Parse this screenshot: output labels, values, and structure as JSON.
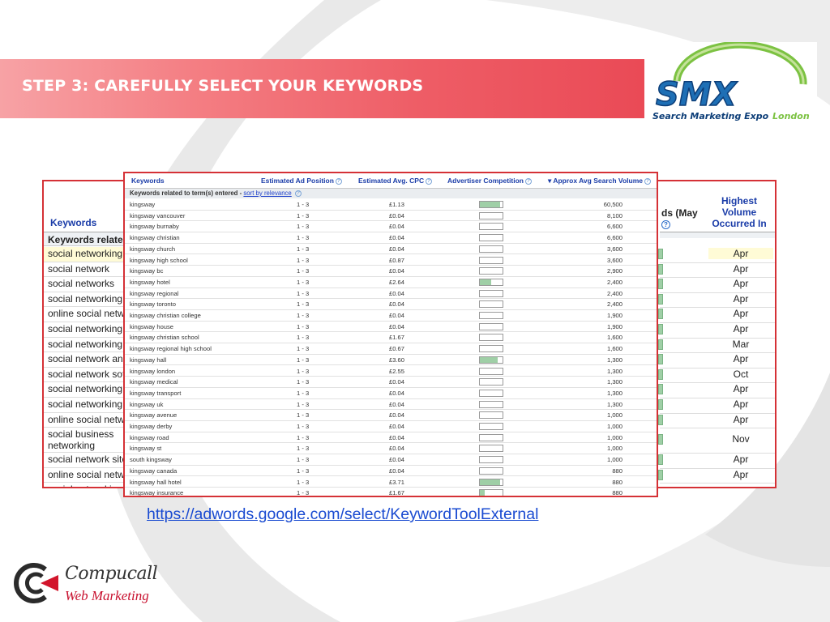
{
  "slide_title": "STEP 3: CAREFULLY SELECT YOUR KEYWORDS",
  "smx_logo": {
    "name": "SMX",
    "tagline_a": "Search Marketing Expo",
    "tagline_b": "London"
  },
  "back_table": {
    "keywords_header": "Keywords",
    "related_label": "Keywords related to term(s) entered",
    "search_header": "ds (May",
    "highest_header": "Highest Volume Occurred In",
    "rows": [
      {
        "kw": "social networking",
        "month": "Apr",
        "highlight": true
      },
      {
        "kw": "social network",
        "month": "Apr"
      },
      {
        "kw": "social networks",
        "month": "Apr"
      },
      {
        "kw": "social networking s",
        "month": "Apr"
      },
      {
        "kw": "online social netwo",
        "month": "Apr"
      },
      {
        "kw": "social networking s",
        "month": "Apr"
      },
      {
        "kw": "social networking s",
        "month": "Mar"
      },
      {
        "kw": "social network ana",
        "month": "Apr"
      },
      {
        "kw": "social network soft",
        "month": "Oct"
      },
      {
        "kw": "social networking w",
        "month": "Apr"
      },
      {
        "kw": "social networking w",
        "month": "Apr"
      },
      {
        "kw": "online social netwo",
        "month": "Apr"
      },
      {
        "kw": "social business networking",
        "month": "Nov"
      },
      {
        "kw": "social network site",
        "month": "Apr"
      },
      {
        "kw": "online social netwo",
        "month": "Apr"
      },
      {
        "kw": "social networking",
        "month": ""
      }
    ]
  },
  "front_table": {
    "headers": {
      "keywords": "Keywords",
      "position": "Estimated Ad Position",
      "cpc": "Estimated Avg. CPC",
      "competition": "Advertiser Competition",
      "volume": "▾ Approx Avg Search Volume"
    },
    "subheader": "Keywords related to term(s) entered - ",
    "sort_link": "sort by relevance",
    "rows": [
      {
        "kw": "kingsway",
        "pos": "1 - 3",
        "cpc": "£1.13",
        "comp": 0.9,
        "vol": "60,500"
      },
      {
        "kw": "kingsway vancouver",
        "pos": "1 - 3",
        "cpc": "£0.04",
        "comp": 0.0,
        "vol": "8,100"
      },
      {
        "kw": "kingsway burnaby",
        "pos": "1 - 3",
        "cpc": "£0.04",
        "comp": 0.0,
        "vol": "6,600"
      },
      {
        "kw": "kingsway christian",
        "pos": "1 - 3",
        "cpc": "£0.04",
        "comp": 0.0,
        "vol": "6,600"
      },
      {
        "kw": "kingsway church",
        "pos": "1 - 3",
        "cpc": "£0.04",
        "comp": 0.0,
        "vol": "3,600"
      },
      {
        "kw": "kingsway high school",
        "pos": "1 - 3",
        "cpc": "£0.87",
        "comp": 0.0,
        "vol": "3,600"
      },
      {
        "kw": "kingsway bc",
        "pos": "1 - 3",
        "cpc": "£0.04",
        "comp": 0.0,
        "vol": "2,900"
      },
      {
        "kw": "kingsway hotel",
        "pos": "1 - 3",
        "cpc": "£2.64",
        "comp": 0.5,
        "vol": "2,400"
      },
      {
        "kw": "kingsway regional",
        "pos": "1 - 3",
        "cpc": "£0.04",
        "comp": 0.0,
        "vol": "2,400"
      },
      {
        "kw": "kingsway toronto",
        "pos": "1 - 3",
        "cpc": "£0.04",
        "comp": 0.0,
        "vol": "2,400"
      },
      {
        "kw": "kingsway christian college",
        "pos": "1 - 3",
        "cpc": "£0.04",
        "comp": 0.0,
        "vol": "1,900"
      },
      {
        "kw": "kingsway house",
        "pos": "1 - 3",
        "cpc": "£0.04",
        "comp": 0.0,
        "vol": "1,900"
      },
      {
        "kw": "kingsway christian school",
        "pos": "1 - 3",
        "cpc": "£1.67",
        "comp": 0.0,
        "vol": "1,600"
      },
      {
        "kw": "kingsway regional high school",
        "pos": "1 - 3",
        "cpc": "£0.67",
        "comp": 0.0,
        "vol": "1,600"
      },
      {
        "kw": "kingsway hall",
        "pos": "1 - 3",
        "cpc": "£3.60",
        "comp": 0.8,
        "vol": "1,300"
      },
      {
        "kw": "kingsway london",
        "pos": "1 - 3",
        "cpc": "£2.55",
        "comp": 0.0,
        "vol": "1,300"
      },
      {
        "kw": "kingsway medical",
        "pos": "1 - 3",
        "cpc": "£0.04",
        "comp": 0.0,
        "vol": "1,300"
      },
      {
        "kw": "kingsway transport",
        "pos": "1 - 3",
        "cpc": "£0.04",
        "comp": 0.0,
        "vol": "1,300"
      },
      {
        "kw": "kingsway uk",
        "pos": "1 - 3",
        "cpc": "£0.04",
        "comp": 0.0,
        "vol": "1,300"
      },
      {
        "kw": "kingsway avenue",
        "pos": "1 - 3",
        "cpc": "£0.04",
        "comp": 0.0,
        "vol": "1,000"
      },
      {
        "kw": "kingsway derby",
        "pos": "1 - 3",
        "cpc": "£0.04",
        "comp": 0.0,
        "vol": "1,000"
      },
      {
        "kw": "kingsway road",
        "pos": "1 - 3",
        "cpc": "£0.04",
        "comp": 0.0,
        "vol": "1,000"
      },
      {
        "kw": "kingsway st",
        "pos": "1 - 3",
        "cpc": "£0.04",
        "comp": 0.0,
        "vol": "1,000"
      },
      {
        "kw": "south kingsway",
        "pos": "1 - 3",
        "cpc": "£0.04",
        "comp": 0.0,
        "vol": "1,000"
      },
      {
        "kw": "kingsway canada",
        "pos": "1 - 3",
        "cpc": "£0.04",
        "comp": 0.0,
        "vol": "880"
      },
      {
        "kw": "kingsway hall hotel",
        "pos": "1 - 3",
        "cpc": "£3.71",
        "comp": 0.9,
        "vol": "880"
      },
      {
        "kw": "kingsway insurance",
        "pos": "1 - 3",
        "cpc": "£1.67",
        "comp": 0.2,
        "vol": "880"
      }
    ]
  },
  "url": "https://adwords.google.com/select/KeywordToolExternal",
  "footer_logo": {
    "name": "Compucall",
    "sub": "Web Marketing"
  },
  "colors": {
    "banner": "#ea4a56",
    "accent_red": "#d53136",
    "link": "#1a4bd1",
    "header_blue": "#1a3ca8"
  }
}
